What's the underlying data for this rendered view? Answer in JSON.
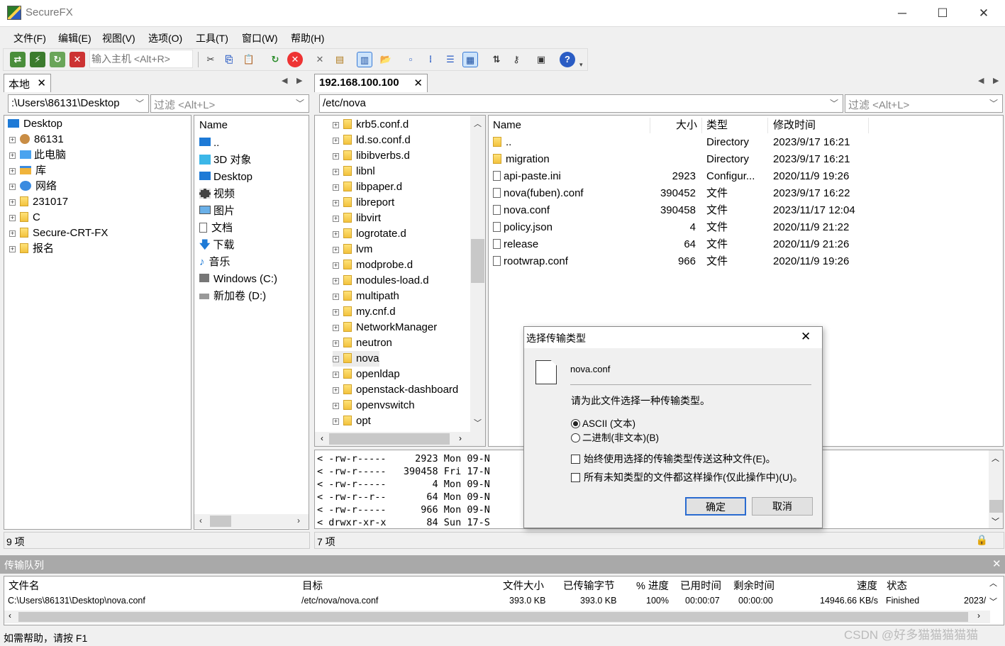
{
  "window": {
    "title": "SecureFX",
    "minimize": "─",
    "maximize": "☐",
    "close": "✕"
  },
  "menu": [
    "文件(F)",
    "编辑(E)",
    "视图(V)",
    "选项(O)",
    "工具(T)",
    "窗口(W)",
    "帮助(H)"
  ],
  "toolbar": {
    "host_placeholder": "输入主机 <Alt+R>"
  },
  "left": {
    "tab_label": "本地",
    "path": ":\\Users\\86131\\Desktop",
    "filter_placeholder": "过滤 <Alt+L>",
    "tree": [
      "Desktop",
      "86131",
      "此电脑",
      "库",
      "网络",
      "231017",
      "C",
      "Secure-CRT-FX",
      "报名"
    ],
    "list_header": "Name",
    "list": [
      "..",
      "3D 对象",
      "Desktop",
      "视频",
      "图片",
      "文档",
      "下载",
      "音乐",
      "Windows (C:)",
      "新加卷 (D:)"
    ],
    "status": "9 项"
  },
  "right": {
    "tab_label": "192.168.100.100",
    "path": "/etc/nova",
    "filter_placeholder": "过滤 <Alt+L>",
    "tree": [
      "krb5.conf.d",
      "ld.so.conf.d",
      "libibverbs.d",
      "libnl",
      "libpaper.d",
      "libreport",
      "libvirt",
      "logrotate.d",
      "lvm",
      "modprobe.d",
      "modules-load.d",
      "multipath",
      "my.cnf.d",
      "NetworkManager",
      "neutron",
      "nova",
      "openldap",
      "openstack-dashboard",
      "openvswitch",
      "opt"
    ],
    "columns": {
      "name": "Name",
      "size": "大小",
      "type": "类型",
      "modified": "修改时间"
    },
    "files": [
      {
        "name": "..",
        "size": "",
        "type": "Directory",
        "modified": "2023/9/17 16:21"
      },
      {
        "name": "migration",
        "size": "",
        "type": "Directory",
        "modified": "2023/9/17 16:21"
      },
      {
        "name": "api-paste.ini",
        "size": "2923",
        "type": "Configur...",
        "modified": "2020/11/9 19:26"
      },
      {
        "name": "nova(fuben).conf",
        "size": "390452",
        "type": "文件",
        "modified": "2023/9/17 16:22"
      },
      {
        "name": "nova.conf",
        "size": "390458",
        "type": "文件",
        "modified": "2023/11/17 12:04"
      },
      {
        "name": "policy.json",
        "size": "4",
        "type": "文件",
        "modified": "2020/11/9 21:22"
      },
      {
        "name": "release",
        "size": "64",
        "type": "文件",
        "modified": "2020/11/9 21:26"
      },
      {
        "name": "rootwrap.conf",
        "size": "966",
        "type": "文件",
        "modified": "2020/11/9 19:26"
      }
    ],
    "log": [
      "< -rw-r-----     2923 Mon 09-N",
      "< -rw-r-----   390458 Fri 17-N",
      "< -rw-r-----        4 Mon 09-N",
      "< -rw-r--r--       64 Mon 09-N",
      "< -rw-r-----      966 Mon 09-N",
      "< drwxr-xr-x       84 Sun 17-S"
    ],
    "status": "7 项"
  },
  "queue": {
    "title": "传输队列",
    "columns": [
      "文件名",
      "目标",
      "文件大小",
      "已传输字节",
      "% 进度",
      "已用时间",
      "剩余时间",
      "速度",
      "状态"
    ],
    "rows": [
      {
        "file": "C:\\Users\\86131\\Desktop\\nova.conf",
        "target": "/etc/nova/nova.conf",
        "size": "393.0 KB",
        "transferred": "393.0 KB",
        "progress": "100%",
        "elapsed": "00:00:07",
        "remaining": "00:00:00",
        "speed": "14946.66 KB/s",
        "status": "Finished",
        "extra": "2023/"
      }
    ]
  },
  "dialog": {
    "title": "选择传输类型",
    "filename": "nova.conf",
    "prompt": "请为此文件选择一种传输类型。",
    "option_ascii": "ASCII (文本)",
    "option_binary": "二进制(非文本)(B)",
    "check_always": "始终使用选择的传输类型传送这种文件(E)。",
    "check_unknown": "所有未知类型的文件都这样操作(仅此操作中)(U)。",
    "ok": "确定",
    "cancel": "取消"
  },
  "statusbar": {
    "help": "如需帮助，请按 F1"
  },
  "watermark": "CSDN @好多猫猫猫猫猫"
}
